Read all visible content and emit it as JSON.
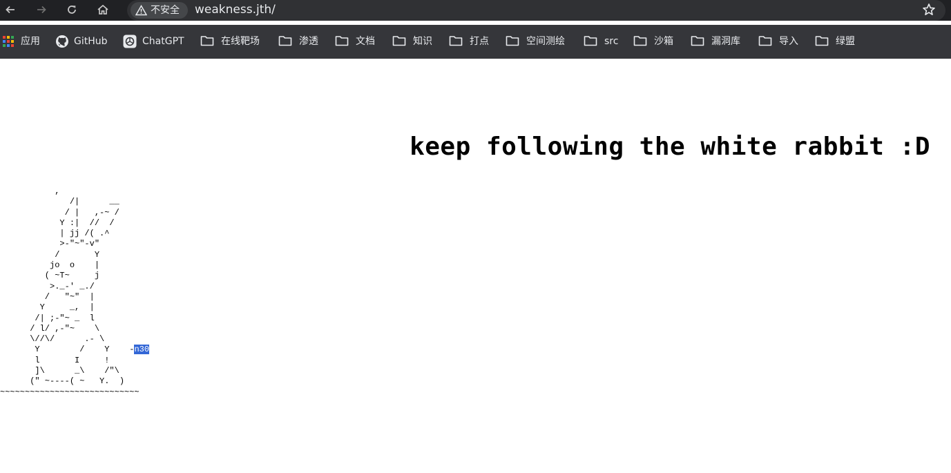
{
  "browser": {
    "security_label": "不安全",
    "url": "weakness.jth/"
  },
  "bookmarks": [
    {
      "label": "应用",
      "icon": "apps-grid-icon"
    },
    {
      "label": "GitHub",
      "icon": "github-icon"
    },
    {
      "label": "ChatGPT",
      "icon": "chatgpt-icon"
    },
    {
      "label": "在线靶场",
      "icon": "folder-icon"
    },
    {
      "label": "渗透",
      "icon": "folder-icon"
    },
    {
      "label": "文档",
      "icon": "folder-icon"
    },
    {
      "label": "知识",
      "icon": "folder-icon"
    },
    {
      "label": "打点",
      "icon": "folder-icon"
    },
    {
      "label": "空间测绘",
      "icon": "folder-icon"
    },
    {
      "label": "src",
      "icon": "folder-icon"
    },
    {
      "label": "沙箱",
      "icon": "folder-icon"
    },
    {
      "label": "漏洞库",
      "icon": "folder-icon"
    },
    {
      "label": "导入",
      "icon": "folder-icon"
    },
    {
      "label": "绿盟",
      "icon": "folder-icon"
    }
  ],
  "page": {
    "heading": "keep following the white rabbit :D",
    "ascii_art": "           ,\n              /|      __\n             / |   ,-~ /\n            Y :|  //  /\n            | jj /( .^\n            >-\"~\"-v\"\n           /       Y\n          jo  o    |\n         ( ~T~     j\n          >._-' _./\n         /   \"~\"  |\n        Y     _,  |\n       /| ;-\"~ _  l\n      / l/ ,-\"~    \\\n      \\//\\/      .- \\\n       Y        /    Y",
    "ascii_tail_prefix": "    -",
    "ascii_selected": "n30",
    "ascii_art_end": "       l       I     !\n       ]\\      _\\    /\"\\\n      (\" ~----( ~   Y.  )\n~~~~~~~~~~~~~~~~~~~~~~~~~~~~"
  }
}
